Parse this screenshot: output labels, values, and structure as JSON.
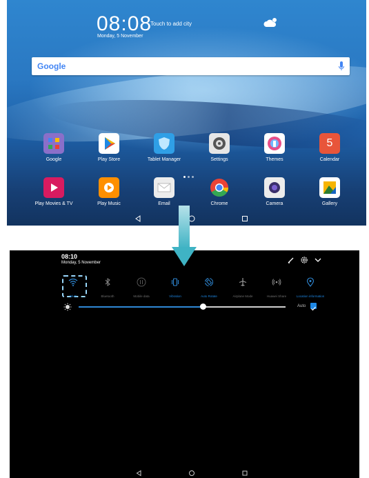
{
  "home": {
    "clock": "08:08",
    "add_city": "Touch to add city",
    "date": "Monday, 5 November",
    "search_logo": "Google",
    "apps_row1": [
      {
        "label": "Google",
        "icon": "google-folder-icon",
        "color": "#8c6ad6"
      },
      {
        "label": "Play Store",
        "icon": "play-store-icon",
        "color": "#ffffff"
      },
      {
        "label": "Tablet Manager",
        "icon": "shield-icon",
        "color": "#2f9fe6"
      },
      {
        "label": "Settings",
        "icon": "gear-icon",
        "color": "#e6e6e6"
      },
      {
        "label": "Themes",
        "icon": "brush-icon",
        "color": "#ffffff"
      },
      {
        "label": "Calendar",
        "icon": "calendar-icon",
        "color": "#e8553a"
      }
    ],
    "calendar_day": "5",
    "apps_row2": [
      {
        "label": "Play Movies & TV",
        "icon": "play-movies-icon",
        "color": "#d81b60"
      },
      {
        "label": "Play Music",
        "icon": "play-music-icon",
        "color": "#ff8f00"
      },
      {
        "label": "Email",
        "icon": "envelope-icon",
        "color": "#eeeeee"
      },
      {
        "label": "Chrome",
        "icon": "chrome-icon",
        "color": "#ffffff"
      },
      {
        "label": "Camera",
        "icon": "camera-icon",
        "color": "#eeeeee"
      },
      {
        "label": "Gallery",
        "icon": "gallery-icon",
        "color": "#ffffff"
      }
    ]
  },
  "panel": {
    "time": "08:10",
    "date": "Monday, 5 November",
    "toggles": [
      {
        "label": "Wi-Fi",
        "active": true,
        "icon": "wifi-icon"
      },
      {
        "label": "Bluetooth",
        "active": false,
        "icon": "bluetooth-icon"
      },
      {
        "label": "Mobile data",
        "active": false,
        "icon": "mobile-data-icon"
      },
      {
        "label": "Vibration",
        "active": true,
        "icon": "vibration-icon"
      },
      {
        "label": "Auto Rotate",
        "active": true,
        "icon": "auto-rotate-icon"
      },
      {
        "label": "Airplane Mode",
        "active": false,
        "icon": "airplane-icon"
      },
      {
        "label": "Huawei Share",
        "active": false,
        "icon": "share-icon"
      },
      {
        "label": "Location information",
        "active": true,
        "icon": "location-icon"
      }
    ],
    "brightness_level": 0.6,
    "auto_label": "Auto",
    "auto_checked": true
  },
  "colors": {
    "accent": "#1e88e5",
    "arrow": "#3fb3c4"
  }
}
